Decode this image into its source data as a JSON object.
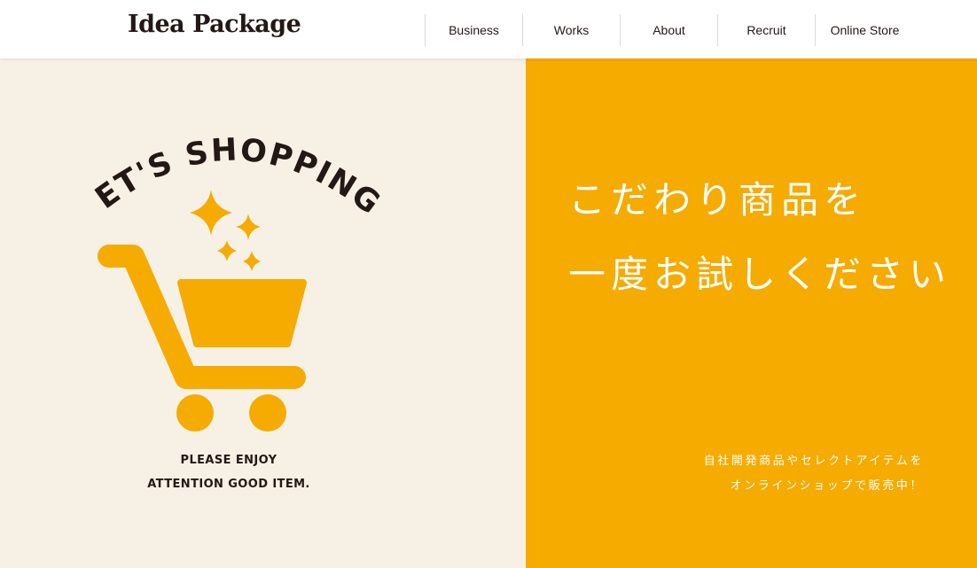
{
  "header": {
    "logo_text": "Idea Package",
    "nav": [
      {
        "label": "Business"
      },
      {
        "label": "Works"
      },
      {
        "label": "About"
      },
      {
        "label": "Recruit"
      },
      {
        "label": "Online Store"
      }
    ]
  },
  "hero": {
    "illustration": {
      "arc_text": "LET'S SHOPPING",
      "icon": "shopping-cart-icon",
      "line1": "PLEASE ENJOY",
      "line2": "ATTENTION GOOD ITEM."
    },
    "headline": {
      "line1": "こだわり商品を",
      "line2": "一度お試しください"
    },
    "subtext": {
      "line1": "自社開発商品やセレクトアイテムを",
      "line2": "オンラインショップで販売中！"
    }
  },
  "colors": {
    "accent_orange": "#f5ab00",
    "cream_background": "#f7f1e5",
    "text_dark": "#231815"
  }
}
